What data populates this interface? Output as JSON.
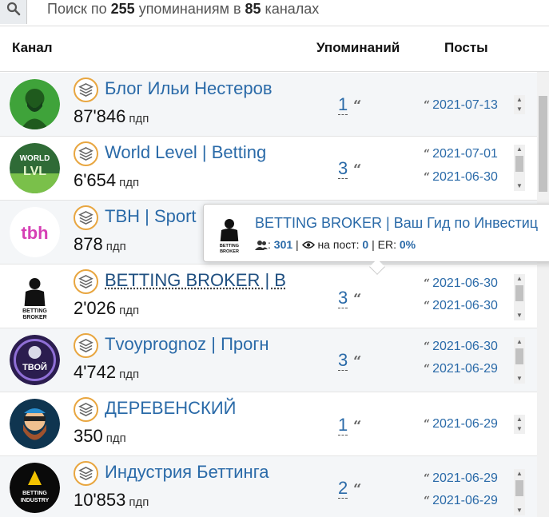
{
  "search": {
    "prefix": "Поиск по ",
    "mentions_total": "255",
    "middle": " упоминаниям в ",
    "channels_total": "85",
    "suffix": " каналах"
  },
  "table": {
    "headers": {
      "channel": "Канал",
      "mentions": "Упоминаний",
      "posts": "Посты"
    },
    "subs_unit": "пдп",
    "rows": [
      {
        "name": "Блог Ильи Нестеров",
        "subscribers": "87'846",
        "mentions": "1",
        "posts": [
          "2021-07-13"
        ]
      },
      {
        "name": "World Level | Betting",
        "subscribers": "6'654",
        "mentions": "3",
        "posts": [
          "2021-07-01",
          "2021-06-30"
        ]
      },
      {
        "name": "ТВН | Sport",
        "subscribers": "878",
        "mentions": "",
        "posts": []
      },
      {
        "name": "BETTING BROKER | B",
        "subscribers": "2'026",
        "mentions": "3",
        "posts": [
          "2021-06-30",
          "2021-06-30"
        ]
      },
      {
        "name": "Tvoyprognoz | Прогн",
        "subscribers": "4'742",
        "mentions": "3",
        "posts": [
          "2021-06-30",
          "2021-06-29"
        ]
      },
      {
        "name": "ДЕРЕВЕНСКИЙ",
        "subscribers": "350",
        "mentions": "1",
        "posts": [
          "2021-06-29"
        ]
      },
      {
        "name": "Индустрия Беттинга",
        "subscribers": "10'853",
        "mentions": "2",
        "posts": [
          "2021-06-29",
          "2021-06-29"
        ]
      }
    ]
  },
  "tooltip": {
    "title": "BETTING BROKER | Ваш Гид по Инвестиц",
    "subscribers": "301",
    "sep1": " | ",
    "per_post_label": "на пост: ",
    "per_post": "0",
    "sep2": " | ER: ",
    "er": "0%"
  },
  "avatars": {
    "row1": "bearded-man-green-avatar",
    "row2": "world-level-logo",
    "row3": "tbh-logo",
    "row4": "betting-broker-silhouette",
    "row5": "tvoy-prognoz-logo",
    "row6": "bearded-cartoon-avatar",
    "row7": "betting-industry-logo"
  },
  "colors": {
    "link": "#2a6aa8",
    "accent_ring": "#e8a640",
    "alt_row": "#f4f6f8"
  }
}
